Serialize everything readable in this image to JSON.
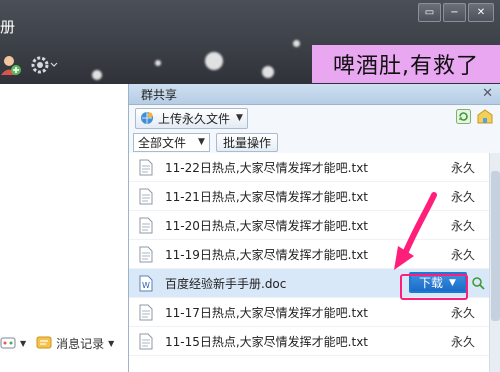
{
  "window": {
    "min_glyph": "▭",
    "max_glyph": "−",
    "close_glyph": "✕",
    "title_tail": "册"
  },
  "caption": {
    "text": "啤酒肚,有救了"
  },
  "panel": {
    "title": "群共享",
    "close_glyph": "✕",
    "upload_label": "上传永久文件",
    "filter_value": "全部文件",
    "batch_label": "批量操作",
    "download_label": "下载"
  },
  "files": [
    {
      "name": "11-22日热点,大家尽情发挥才能吧.txt",
      "status": "永久"
    },
    {
      "name": "11-21日热点,大家尽情发挥才能吧.txt",
      "status": "永久"
    },
    {
      "name": "11-20日热点,大家尽情发挥才能吧.txt",
      "status": "永久"
    },
    {
      "name": "11-19日热点,大家尽情发挥才能吧.txt",
      "status": "永久"
    },
    {
      "name": "百度经验新手手册.doc",
      "status": ""
    },
    {
      "name": "11-17日热点,大家尽情发挥才能吧.txt",
      "status": "永久"
    },
    {
      "name": "11-15日热点,大家尽情发挥才能吧.txt",
      "status": "永久"
    }
  ],
  "left": {
    "msg_history_label": "消息记录"
  },
  "colors": {
    "highlight_arrow": "#ff1f7a",
    "caption_bg": "#e9a6f1",
    "download_bg": "#2a7fd7"
  }
}
